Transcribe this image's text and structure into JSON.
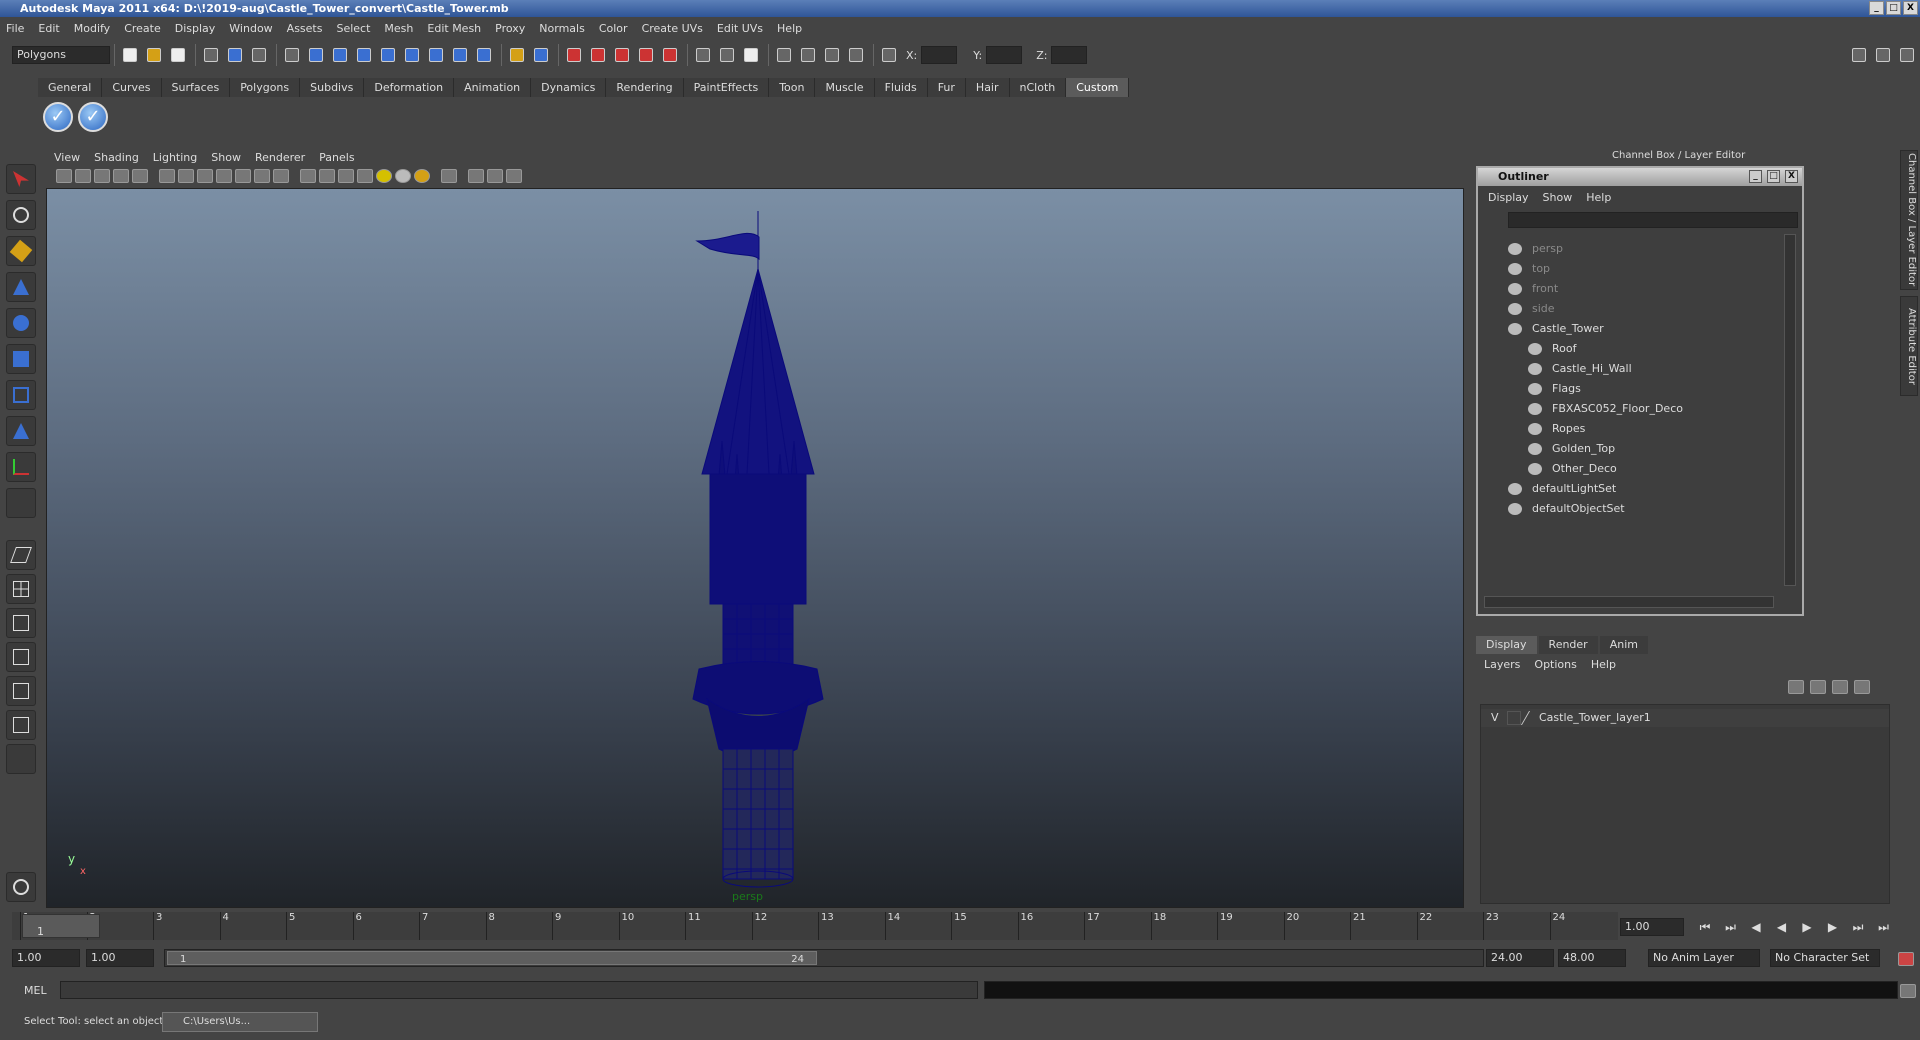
{
  "window": {
    "title": "Autodesk Maya 2011 x64: D:\\!2019-aug\\Castle_Tower_convert\\Castle_Tower.mb",
    "controls": [
      "_",
      "□",
      "X"
    ]
  },
  "menubar": [
    "File",
    "Edit",
    "Modify",
    "Create",
    "Display",
    "Window",
    "Assets",
    "Select",
    "Mesh",
    "Edit Mesh",
    "Proxy",
    "Normals",
    "Color",
    "Create UVs",
    "Edit UVs",
    "Help"
  ],
  "statusline": {
    "mode": "Polygons",
    "x_label": "X:",
    "y_label": "Y:",
    "z_label": "Z:"
  },
  "shelf": {
    "tabs": [
      "General",
      "Curves",
      "Surfaces",
      "Polygons",
      "Subdivs",
      "Deformation",
      "Animation",
      "Dynamics",
      "Rendering",
      "PaintEffects",
      "Toon",
      "Muscle",
      "Fluids",
      "Fur",
      "Hair",
      "nCloth",
      "Custom"
    ],
    "active": "Custom",
    "buttons": [
      "✓",
      "✓"
    ]
  },
  "viewport": {
    "menus": [
      "View",
      "Shading",
      "Lighting",
      "Show",
      "Renderer",
      "Panels"
    ],
    "camera": "persp",
    "axis_y": "y",
    "axis_x": "x",
    "wire_color": "#0a0a7a"
  },
  "channel_box": {
    "title": "Channel Box / Layer Editor"
  },
  "outliner": {
    "title": "Outliner",
    "menus": [
      "Display",
      "Show",
      "Help"
    ],
    "items": [
      {
        "label": "persp",
        "level": 0,
        "dim": true
      },
      {
        "label": "top",
        "level": 0,
        "dim": true
      },
      {
        "label": "front",
        "level": 0,
        "dim": true
      },
      {
        "label": "side",
        "level": 0,
        "dim": true
      },
      {
        "label": "Castle_Tower",
        "level": 0,
        "dim": false
      },
      {
        "label": "Roof",
        "level": 1,
        "dim": false
      },
      {
        "label": "Castle_Hi_Wall",
        "level": 1,
        "dim": false
      },
      {
        "label": "Flags",
        "level": 1,
        "dim": false
      },
      {
        "label": "FBXASC052_Floor_Deco",
        "level": 1,
        "dim": false
      },
      {
        "label": "Ropes",
        "level": 1,
        "dim": false
      },
      {
        "label": "Golden_Top",
        "level": 1,
        "dim": false
      },
      {
        "label": "Other_Deco",
        "level": 1,
        "dim": false
      },
      {
        "label": "defaultLightSet",
        "level": 0,
        "dim": false
      },
      {
        "label": "defaultObjectSet",
        "level": 0,
        "dim": false
      }
    ]
  },
  "layers": {
    "tabs": [
      "Display",
      "Render",
      "Anim"
    ],
    "active": "Display",
    "menus": [
      "Layers",
      "Options",
      "Help"
    ],
    "row": {
      "visible": "V",
      "name": "Castle_Tower_layer1"
    }
  },
  "sidetabs": [
    "Channel Box / Layer Editor",
    "Attribute Editor"
  ],
  "timeline": {
    "ticks": [
      "1",
      "2",
      "3",
      "4",
      "5",
      "6",
      "7",
      "8",
      "9",
      "10",
      "11",
      "12",
      "13",
      "14",
      "15",
      "16",
      "17",
      "18",
      "19",
      "20",
      "21",
      "22",
      "23",
      "24"
    ],
    "current": "1",
    "current_field": "1.00"
  },
  "range": {
    "start": "1.00",
    "start2": "1.00",
    "slider_start": "1",
    "slider_end": "24",
    "end": "24.00",
    "end2": "48.00",
    "anim_layer": "No Anim Layer",
    "char_set": "No Character Set"
  },
  "mel": {
    "label": "MEL"
  },
  "help": {
    "text": "Select Tool: select an object",
    "taskbar": "C:\\Users\\Us..."
  }
}
